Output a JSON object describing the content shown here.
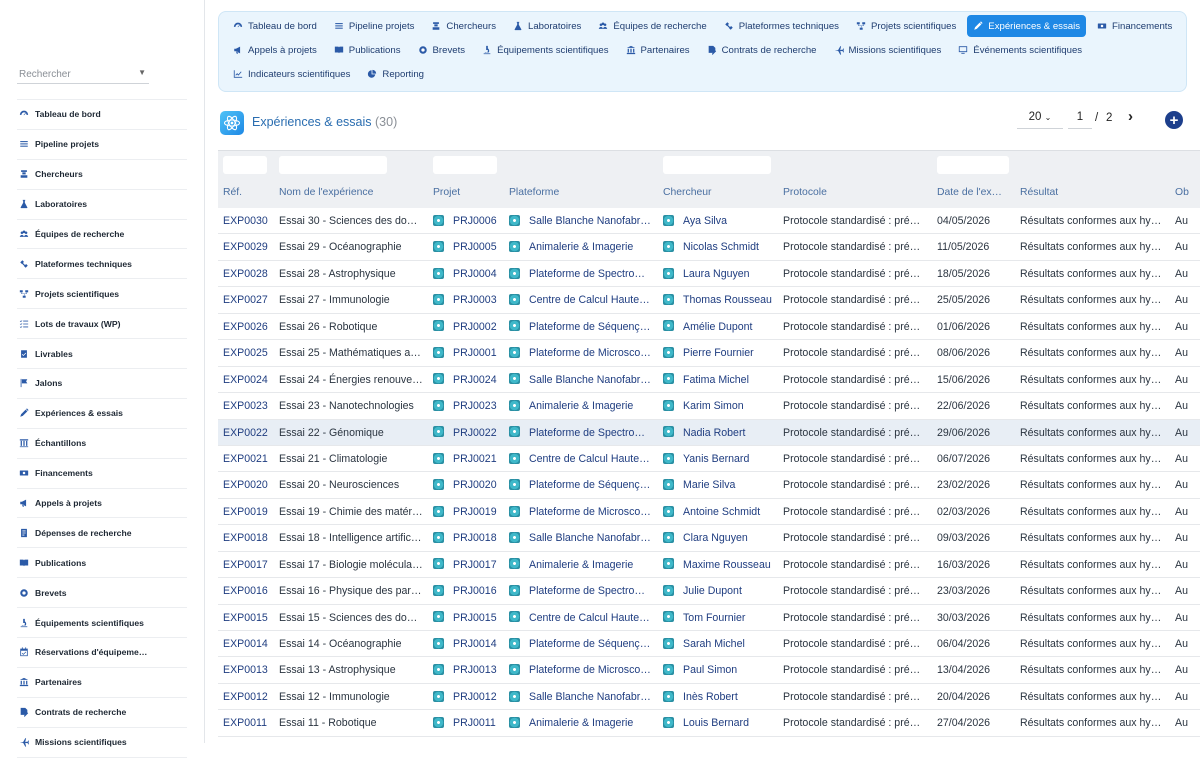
{
  "top_nav": {
    "rows": [
      [
        {
          "label": "Tableau de bord",
          "icon": "dashboard-icon"
        },
        {
          "label": "Pipeline projets",
          "icon": "list-icon"
        },
        {
          "label": "Chercheurs",
          "icon": "researcher-icon"
        },
        {
          "label": "Laboratoires",
          "icon": "flask-icon"
        },
        {
          "label": "Équipes de recherche",
          "icon": "team-icon"
        },
        {
          "label": "Plateformes techniques",
          "icon": "satellite-icon"
        },
        {
          "label": "Projets scientifiques",
          "icon": "project-tree-icon"
        },
        {
          "label": "Expériences & essais",
          "icon": "pen-icon",
          "active": true
        },
        {
          "label": "Financements",
          "icon": "money-icon"
        }
      ],
      [
        {
          "label": "Appels à projets",
          "icon": "megaphone-icon"
        },
        {
          "label": "Publications",
          "icon": "book-icon"
        },
        {
          "label": "Brevets",
          "icon": "patent-icon"
        },
        {
          "label": "Équipements scientifiques",
          "icon": "microscope-icon"
        },
        {
          "label": "Partenaires",
          "icon": "institution-icon"
        },
        {
          "label": "Contrats de recherche",
          "icon": "contract-icon"
        },
        {
          "label": "Missions scientifiques",
          "icon": "plane-icon"
        },
        {
          "label": "Événements scientifiques",
          "icon": "monitor-icon"
        }
      ],
      [
        {
          "label": "Indicateurs scientifiques",
          "icon": "chart-icon"
        },
        {
          "label": "Reporting",
          "icon": "pie-icon"
        }
      ]
    ]
  },
  "sidebar": {
    "search_placeholder": "Rechercher",
    "items": [
      {
        "label": "Tableau de bord",
        "icon": "dashboard-icon"
      },
      {
        "label": "Pipeline projets",
        "icon": "list-icon"
      },
      {
        "label": "Chercheurs",
        "icon": "researcher-icon"
      },
      {
        "label": "Laboratoires",
        "icon": "flask-icon"
      },
      {
        "label": "Équipes de recherche",
        "icon": "team-icon"
      },
      {
        "label": "Plateformes techniques",
        "icon": "satellite-icon"
      },
      {
        "label": "Projets scientifiques",
        "icon": "project-tree-icon"
      },
      {
        "label": "Lots de travaux (WP)",
        "icon": "checklist-icon"
      },
      {
        "label": "Livrables",
        "icon": "deliverable-icon"
      },
      {
        "label": "Jalons",
        "icon": "flag-icon"
      },
      {
        "label": "Expériences & essais",
        "icon": "pen-icon"
      },
      {
        "label": "Échantillons",
        "icon": "sample-icon"
      },
      {
        "label": "Financements",
        "icon": "money-icon"
      },
      {
        "label": "Appels à projets",
        "icon": "megaphone-icon"
      },
      {
        "label": "Dépenses de recherche",
        "icon": "expense-icon"
      },
      {
        "label": "Publications",
        "icon": "book-icon"
      },
      {
        "label": "Brevets",
        "icon": "patent-icon"
      },
      {
        "label": "Équipements scientifiques",
        "icon": "microscope-icon"
      },
      {
        "label": "Réservations d'équipeme…",
        "icon": "reservation-icon"
      },
      {
        "label": "Partenaires",
        "icon": "institution-icon"
      },
      {
        "label": "Contrats de recherche",
        "icon": "contract-icon"
      },
      {
        "label": "Missions scientifiques",
        "icon": "plane-icon"
      }
    ]
  },
  "header": {
    "title": "Expériences & essais",
    "count": "(30)",
    "icon": "atom-icon"
  },
  "pager": {
    "page_size": "20",
    "current_page": "1",
    "separator": "/",
    "total_pages": "2",
    "next": "›",
    "add": "+"
  },
  "table": {
    "columns": [
      "Réf.",
      "Nom de l'expérience",
      "Projet",
      "Plateforme",
      "Chercheur",
      "Protocole",
      "Date de l'ex…",
      "Résultat",
      "Ob"
    ],
    "rows": [
      [
        "EXP0030",
        "Essai 30 - Sciences des do…",
        "PRJ0006",
        "Salle Blanche Nanofabr…",
        "Aya Silva",
        "Protocole standardisé : prép…",
        "04/05/2026",
        "Résultats conformes aux hy…",
        "Au"
      ],
      [
        "EXP0029",
        "Essai 29 - Océanographie",
        "PRJ0005",
        "Animalerie & Imagerie",
        "Nicolas Schmidt",
        "Protocole standardisé : prép…",
        "11/05/2026",
        "Résultats conformes aux hy…",
        "Au"
      ],
      [
        "EXP0028",
        "Essai 28 - Astrophysique",
        "PRJ0004",
        "Plateforme de Spectro…",
        "Laura Nguyen",
        "Protocole standardisé : prép…",
        "18/05/2026",
        "Résultats conformes aux hy…",
        "Au"
      ],
      [
        "EXP0027",
        "Essai 27 - Immunologie",
        "PRJ0003",
        "Centre de Calcul Haute…",
        "Thomas Rousseau",
        "Protocole standardisé : prép…",
        "25/05/2026",
        "Résultats conformes aux hy…",
        "Au"
      ],
      [
        "EXP0026",
        "Essai 26 - Robotique",
        "PRJ0002",
        "Plateforme de Séquenç…",
        "Amélie Dupont",
        "Protocole standardisé : prép…",
        "01/06/2026",
        "Résultats conformes aux hy…",
        "Au"
      ],
      [
        "EXP0025",
        "Essai 25 - Mathématiques a…",
        "PRJ0001",
        "Plateforme de Microsco…",
        "Pierre Fournier",
        "Protocole standardisé : prép…",
        "08/06/2026",
        "Résultats conformes aux hy…",
        "Au"
      ],
      [
        "EXP0024",
        "Essai 24 - Énergies renouve…",
        "PRJ0024",
        "Salle Blanche Nanofabr…",
        "Fatima Michel",
        "Protocole standardisé : prép…",
        "15/06/2026",
        "Résultats conformes aux hy…",
        "Au"
      ],
      [
        "EXP0023",
        "Essai 23 - Nanotechnologies",
        "PRJ0023",
        "Animalerie & Imagerie",
        "Karim Simon",
        "Protocole standardisé : prép…",
        "22/06/2026",
        "Résultats conformes aux hy…",
        "Au"
      ],
      [
        "EXP0022",
        "Essai 22 - Génomique",
        "PRJ0022",
        "Plateforme de Spectro…",
        "Nadia Robert",
        "Protocole standardisé : prép…",
        "29/06/2026",
        "Résultats conformes aux hy…",
        "Au"
      ],
      [
        "EXP0021",
        "Essai 21 - Climatologie",
        "PRJ0021",
        "Centre de Calcul Haute…",
        "Yanis Bernard",
        "Protocole standardisé : prép…",
        "06/07/2026",
        "Résultats conformes aux hy…",
        "Au"
      ],
      [
        "EXP0020",
        "Essai 20 - Neurosciences",
        "PRJ0020",
        "Plateforme de Séquenç…",
        "Marie Silva",
        "Protocole standardisé : prép…",
        "23/02/2026",
        "Résultats conformes aux hy…",
        "Au"
      ],
      [
        "EXP0019",
        "Essai 19 - Chimie des matér…",
        "PRJ0019",
        "Plateforme de Microsco…",
        "Antoine Schmidt",
        "Protocole standardisé : prép…",
        "02/03/2026",
        "Résultats conformes aux hy…",
        "Au"
      ],
      [
        "EXP0018",
        "Essai 18 - Intelligence artific…",
        "PRJ0018",
        "Salle Blanche Nanofabr…",
        "Clara Nguyen",
        "Protocole standardisé : prép…",
        "09/03/2026",
        "Résultats conformes aux hy…",
        "Au"
      ],
      [
        "EXP0017",
        "Essai 17 - Biologie molécula…",
        "PRJ0017",
        "Animalerie & Imagerie",
        "Maxime Rousseau",
        "Protocole standardisé : prép…",
        "16/03/2026",
        "Résultats conformes aux hy…",
        "Au"
      ],
      [
        "EXP0016",
        "Essai 16 - Physique des par…",
        "PRJ0016",
        "Plateforme de Spectro…",
        "Julie Dupont",
        "Protocole standardisé : prép…",
        "23/03/2026",
        "Résultats conformes aux hy…",
        "Au"
      ],
      [
        "EXP0015",
        "Essai 15 - Sciences des do…",
        "PRJ0015",
        "Centre de Calcul Haute…",
        "Tom Fournier",
        "Protocole standardisé : prép…",
        "30/03/2026",
        "Résultats conformes aux hy…",
        "Au"
      ],
      [
        "EXP0014",
        "Essai 14 - Océanographie",
        "PRJ0014",
        "Plateforme de Séquenç…",
        "Sarah Michel",
        "Protocole standardisé : prép…",
        "06/04/2026",
        "Résultats conformes aux hy…",
        "Au"
      ],
      [
        "EXP0013",
        "Essai 13 - Astrophysique",
        "PRJ0013",
        "Plateforme de Microsco…",
        "Paul Simon",
        "Protocole standardisé : prép…",
        "13/04/2026",
        "Résultats conformes aux hy…",
        "Au"
      ],
      [
        "EXP0012",
        "Essai 12 - Immunologie",
        "PRJ0012",
        "Salle Blanche Nanofabr…",
        "Inès Robert",
        "Protocole standardisé : prép…",
        "20/04/2026",
        "Résultats conformes aux hy…",
        "Au"
      ],
      [
        "EXP0011",
        "Essai 11 - Robotique",
        "PRJ0011",
        "Animalerie & Imagerie",
        "Louis Bernard",
        "Protocole standardisé : prép…",
        "27/04/2026",
        "Résultats conformes aux hy…",
        "Au"
      ]
    ],
    "highlighted_row": 8
  },
  "colors": {
    "accent": "#1e88e5",
    "nav_bg": "#eaf5fd",
    "link": "#1f3d80",
    "header_text": "#4a6fa1",
    "add_button": "#1d3f8c"
  }
}
